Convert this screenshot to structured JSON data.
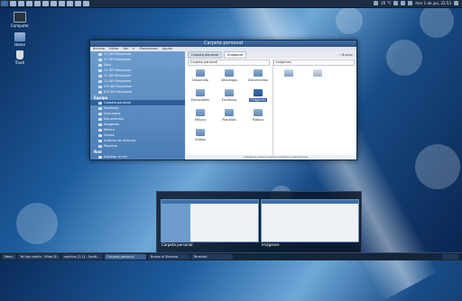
{
  "top_panel": {
    "right_text_a": "20 °C",
    "clock": "mar 1 de jun, 22:53"
  },
  "desktop_icons": [
    {
      "label": "Computer",
      "icon": "computer-icon"
    },
    {
      "label": "Home",
      "icon": "home-folder-icon"
    },
    {
      "label": "Trash",
      "icon": "trash-icon"
    }
  ],
  "window": {
    "title": "Carpeta personal",
    "menu": [
      "Archivo",
      "Editar",
      "Ver",
      "Ir",
      "Marcadores",
      "Ayuda"
    ],
    "sidebar": {
      "bookmarks": [
        "11 GB Filesystem",
        "11 GB Filesystem",
        "Ubia",
        "11 GB Filesystem",
        "11 GB Filesystem",
        "11 GB Filesystem",
        "5.6 GB Filesystem",
        "6.6 GB Filesystem"
      ],
      "section_equipo": "Equipo",
      "equipo_items": [
        "Carpeta personal",
        "Escritorio",
        "Descargas",
        "Documentos",
        "Imágenes",
        "Música",
        "Vídeos",
        "Sistema de archivos",
        "Papelera"
      ],
      "section_red": "Red",
      "red_items": [
        "Explorar la red"
      ]
    },
    "toolbar": {
      "crumbs": [
        "Carpeta personal",
        "Imágenes"
      ],
      "search_label": "Buscar"
    },
    "left_pane": {
      "path": "Carpeta personal",
      "items": [
        "Desarrollo",
        "Descargas",
        "Documentos",
        "Ejecutables",
        "Escritorio",
        "Imágenes",
        "Música",
        "Plantillas",
        "Público",
        "Vídeos"
      ],
      "selected": "Imágenes"
    },
    "right_pane": {
      "path": "Imágenes",
      "items": [
        "",
        "",
        "",
        ""
      ]
    },
    "status": "Imágenes seleccionada (contiene 4 elementos)"
  },
  "switcher": {
    "items": [
      {
        "caption": "Carpeta personal"
      },
      {
        "caption": "Imágenes"
      }
    ]
  },
  "bottom_panel": {
    "menu_label": "Menú",
    "tasks": [
      "Ya has vuelto - What D...",
      "nautilus [1.1] - GeoB...",
      "Carpeta personal",
      "Nuevo el Sistema",
      "Terminal"
    ]
  }
}
